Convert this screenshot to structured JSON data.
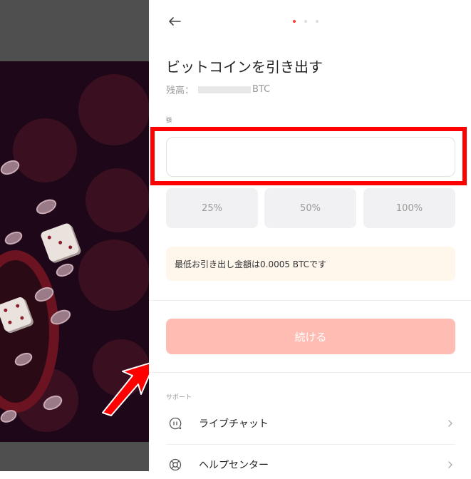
{
  "header": {
    "title": "ビットコインを引き出す",
    "balance_label": "残高：",
    "balance_currency": "BTC"
  },
  "form": {
    "amount_label": "額",
    "amount_value": "",
    "percent_buttons": [
      "25%",
      "50%",
      "100%"
    ],
    "notice": "最低お引き出し金額は0.0005 BTCです",
    "continue_label": "続ける"
  },
  "support": {
    "section_label": "サポート",
    "items": [
      {
        "label": "ライブチャット",
        "icon": "chat-icon"
      },
      {
        "label": "ヘルプセンター",
        "icon": "lifebuoy-icon"
      }
    ]
  },
  "colors": {
    "accent": "#ff3b30",
    "continue_bg": "#ffbcb3",
    "highlight": "#ff0000",
    "notice_bg": "#fff6ec"
  },
  "stepper": {
    "total": 3,
    "active": 1
  }
}
